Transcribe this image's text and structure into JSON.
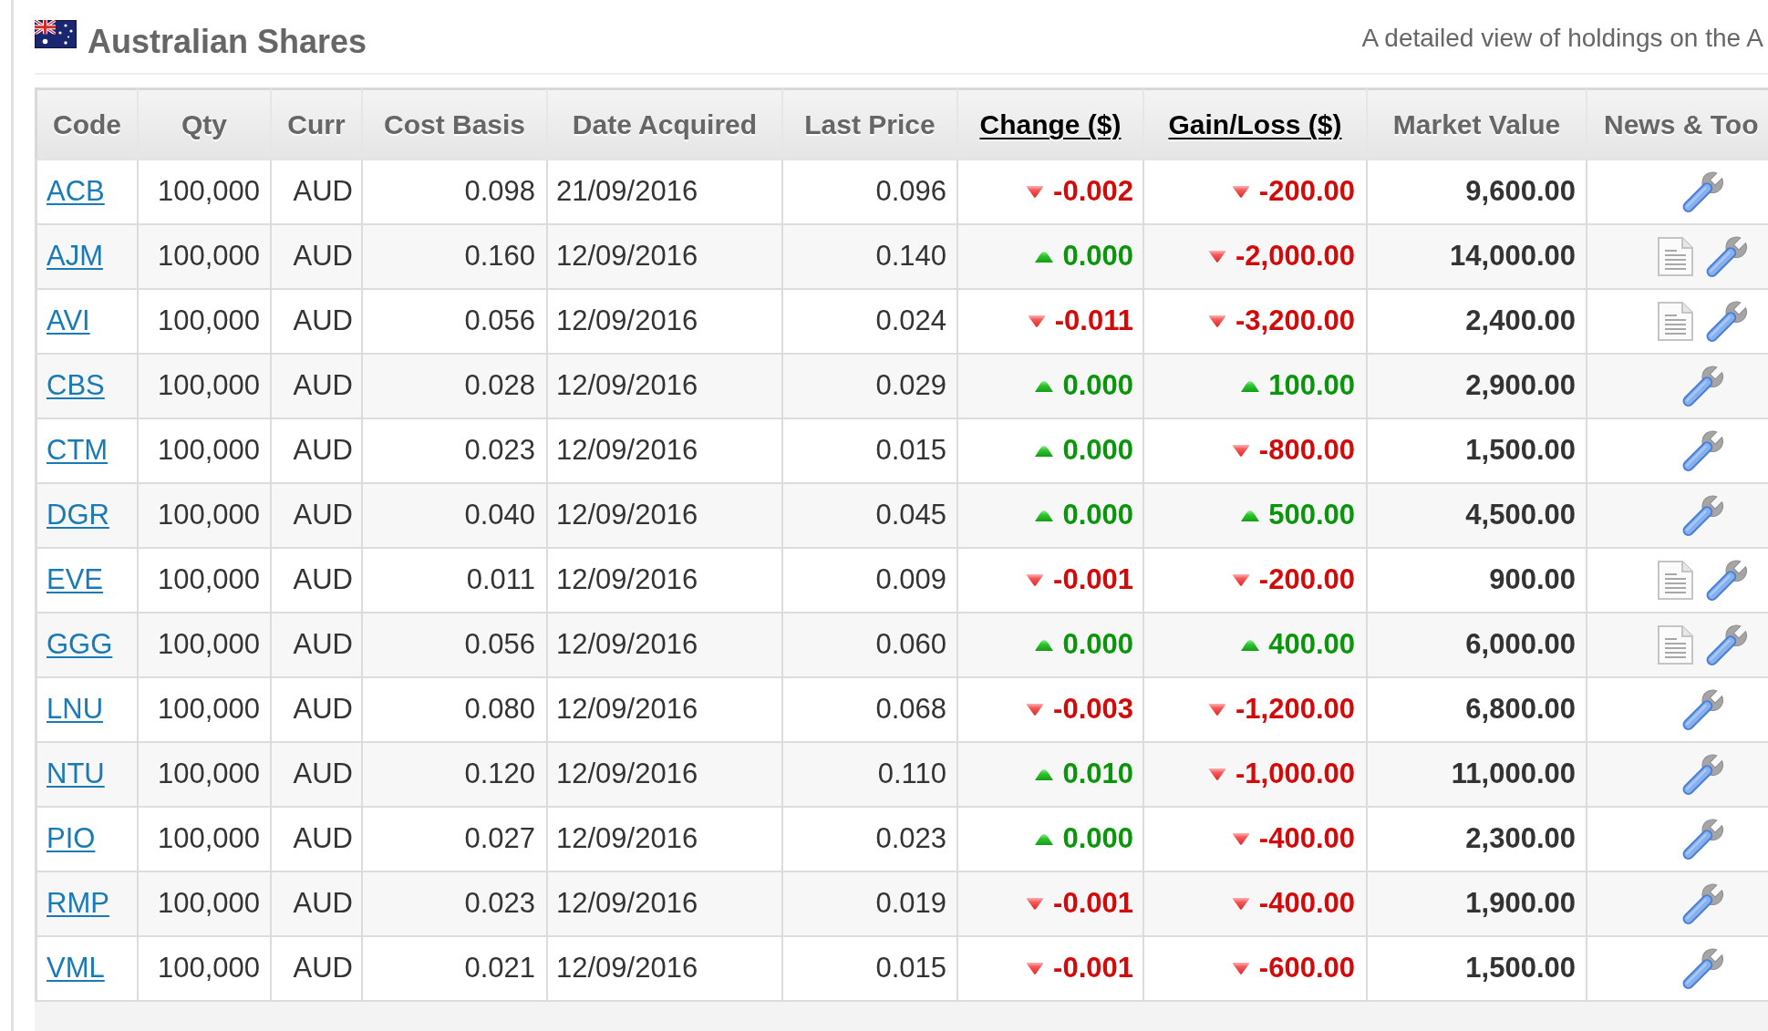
{
  "header": {
    "title": "Australian Shares",
    "subtitle": "A detailed view of holdings on the A"
  },
  "table": {
    "columns": [
      {
        "label": "Code",
        "kind": "plain"
      },
      {
        "label": "Qty",
        "kind": "plain"
      },
      {
        "label": "Curr",
        "kind": "plain"
      },
      {
        "label": "Cost Basis",
        "kind": "plain"
      },
      {
        "label": "Date Acquired",
        "kind": "plain"
      },
      {
        "label": "Last Price",
        "kind": "plain"
      },
      {
        "label": "Change ($)",
        "kind": "sort_link"
      },
      {
        "label": "Gain/Loss ($)",
        "kind": "sort_link"
      },
      {
        "label": "Market Value",
        "kind": "plain"
      },
      {
        "label": "News & Too",
        "kind": "plain"
      }
    ],
    "rows": [
      {
        "code": "ACB",
        "qty": "100,000",
        "curr": "AUD",
        "cost_basis": "0.098",
        "date_acquired": "21/09/2016",
        "last_price": "0.096",
        "change": {
          "value": "-0.002",
          "rising": false
        },
        "gain_loss": {
          "value": "-200.00",
          "rising": false
        },
        "market_value": "9,600.00",
        "news": false
      },
      {
        "code": "AJM",
        "qty": "100,000",
        "curr": "AUD",
        "cost_basis": "0.160",
        "date_acquired": "12/09/2016",
        "last_price": "0.140",
        "change": {
          "value": "0.000",
          "rising": true
        },
        "gain_loss": {
          "value": "-2,000.00",
          "rising": false
        },
        "market_value": "14,000.00",
        "news": true
      },
      {
        "code": "AVI",
        "qty": "100,000",
        "curr": "AUD",
        "cost_basis": "0.056",
        "date_acquired": "12/09/2016",
        "last_price": "0.024",
        "change": {
          "value": "-0.011",
          "rising": false
        },
        "gain_loss": {
          "value": "-3,200.00",
          "rising": false
        },
        "market_value": "2,400.00",
        "news": true
      },
      {
        "code": "CBS",
        "qty": "100,000",
        "curr": "AUD",
        "cost_basis": "0.028",
        "date_acquired": "12/09/2016",
        "last_price": "0.029",
        "change": {
          "value": "0.000",
          "rising": true
        },
        "gain_loss": {
          "value": "100.00",
          "rising": true
        },
        "market_value": "2,900.00",
        "news": false
      },
      {
        "code": "CTM",
        "qty": "100,000",
        "curr": "AUD",
        "cost_basis": "0.023",
        "date_acquired": "12/09/2016",
        "last_price": "0.015",
        "change": {
          "value": "0.000",
          "rising": true
        },
        "gain_loss": {
          "value": "-800.00",
          "rising": false
        },
        "market_value": "1,500.00",
        "news": false
      },
      {
        "code": "DGR",
        "qty": "100,000",
        "curr": "AUD",
        "cost_basis": "0.040",
        "date_acquired": "12/09/2016",
        "last_price": "0.045",
        "change": {
          "value": "0.000",
          "rising": true
        },
        "gain_loss": {
          "value": "500.00",
          "rising": true
        },
        "market_value": "4,500.00",
        "news": false
      },
      {
        "code": "EVE",
        "qty": "100,000",
        "curr": "AUD",
        "cost_basis": "0.011",
        "date_acquired": "12/09/2016",
        "last_price": "0.009",
        "change": {
          "value": "-0.001",
          "rising": false
        },
        "gain_loss": {
          "value": "-200.00",
          "rising": false
        },
        "market_value": "900.00",
        "news": true
      },
      {
        "code": "GGG",
        "qty": "100,000",
        "curr": "AUD",
        "cost_basis": "0.056",
        "date_acquired": "12/09/2016",
        "last_price": "0.060",
        "change": {
          "value": "0.000",
          "rising": true
        },
        "gain_loss": {
          "value": "400.00",
          "rising": true
        },
        "market_value": "6,000.00",
        "news": true
      },
      {
        "code": "LNU",
        "qty": "100,000",
        "curr": "AUD",
        "cost_basis": "0.080",
        "date_acquired": "12/09/2016",
        "last_price": "0.068",
        "change": {
          "value": "-0.003",
          "rising": false
        },
        "gain_loss": {
          "value": "-1,200.00",
          "rising": false
        },
        "market_value": "6,800.00",
        "news": false
      },
      {
        "code": "NTU",
        "qty": "100,000",
        "curr": "AUD",
        "cost_basis": "0.120",
        "date_acquired": "12/09/2016",
        "last_price": "0.110",
        "change": {
          "value": "0.010",
          "rising": true
        },
        "gain_loss": {
          "value": "-1,000.00",
          "rising": false
        },
        "market_value": "11,000.00",
        "news": false
      },
      {
        "code": "PIO",
        "qty": "100,000",
        "curr": "AUD",
        "cost_basis": "0.027",
        "date_acquired": "12/09/2016",
        "last_price": "0.023",
        "change": {
          "value": "0.000",
          "rising": true
        },
        "gain_loss": {
          "value": "-400.00",
          "rising": false
        },
        "market_value": "2,300.00",
        "news": false
      },
      {
        "code": "RMP",
        "qty": "100,000",
        "curr": "AUD",
        "cost_basis": "0.023",
        "date_acquired": "12/09/2016",
        "last_price": "0.019",
        "change": {
          "value": "-0.001",
          "rising": false
        },
        "gain_loss": {
          "value": "-400.00",
          "rising": false
        },
        "market_value": "1,900.00",
        "news": false
      },
      {
        "code": "VML",
        "qty": "100,000",
        "curr": "AUD",
        "cost_basis": "0.021",
        "date_acquired": "12/09/2016",
        "last_price": "0.015",
        "change": {
          "value": "-0.001",
          "rising": false
        },
        "gain_loss": {
          "value": "-600.00",
          "rising": false
        },
        "market_value": "1,500.00",
        "news": false
      }
    ]
  }
}
